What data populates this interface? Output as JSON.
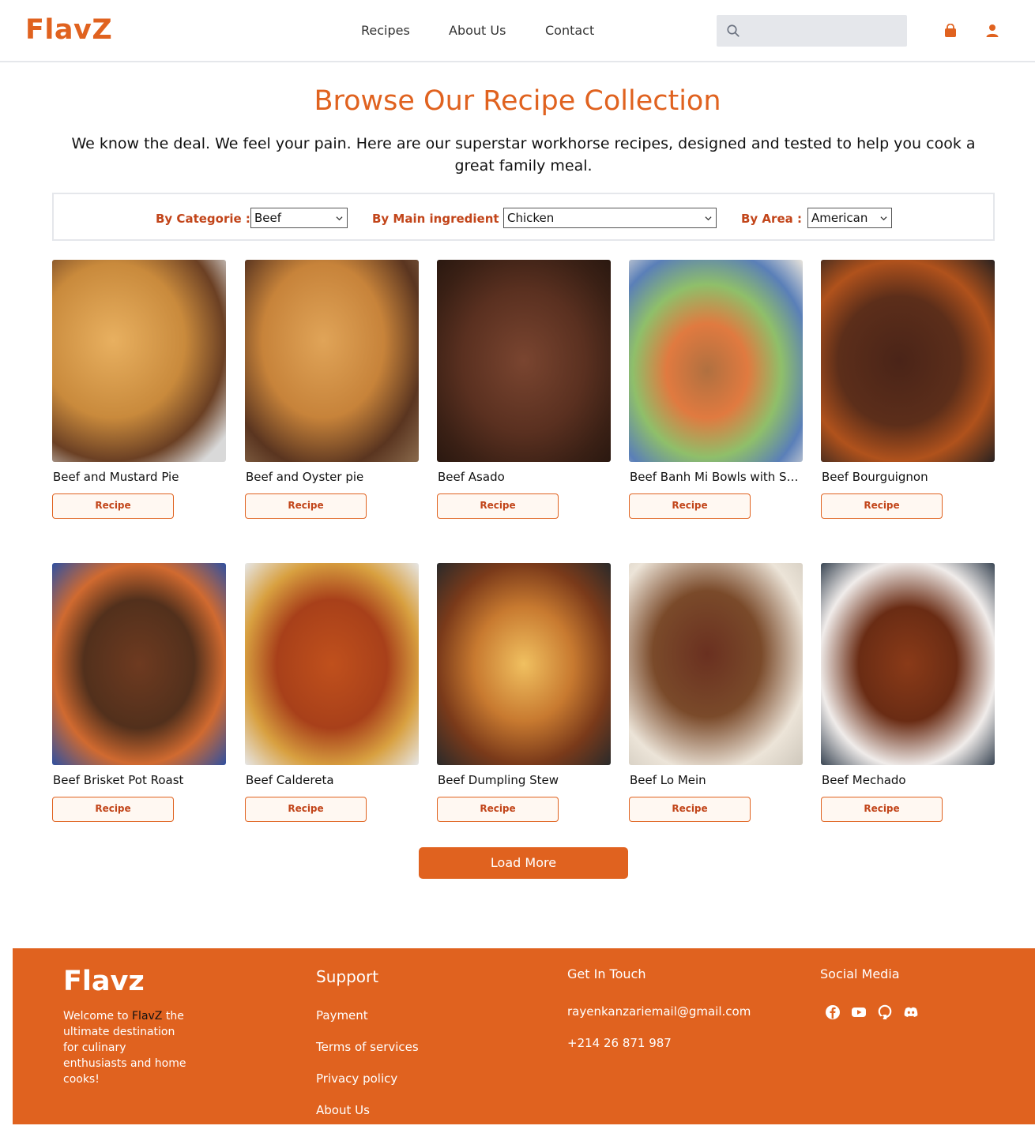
{
  "header": {
    "logo": "FlavZ",
    "nav": [
      "Recipes",
      "About Us",
      "Contact"
    ],
    "search_placeholder": ""
  },
  "hero": {
    "title": "Browse Our Recipe Collection",
    "subtitle": "We know the deal. We feel your pain. Here are our superstar workhorse recipes, designed and tested to help you cook a great family meal."
  },
  "filters": {
    "category_label": "By Categorie :",
    "category_value": "Beef",
    "ingredient_label": "By Main ingredient :",
    "ingredient_value": "Chicken",
    "area_label": "By Area :",
    "area_value": "American"
  },
  "recipes": [
    {
      "name": "Beef and Mustard Pie",
      "button": "Recipe"
    },
    {
      "name": "Beef and Oyster pie",
      "button": "Recipe"
    },
    {
      "name": "Beef Asado",
      "button": "Recipe"
    },
    {
      "name": "Beef Banh Mi Bowls with Sriracha Mayo, Carrot & Pickled Cucumber",
      "button": "Recipe"
    },
    {
      "name": "Beef Bourguignon",
      "button": "Recipe"
    },
    {
      "name": "Beef Brisket Pot Roast",
      "button": "Recipe"
    },
    {
      "name": "Beef Caldereta",
      "button": "Recipe"
    },
    {
      "name": "Beef Dumpling Stew",
      "button": "Recipe"
    },
    {
      "name": "Beef Lo Mein",
      "button": "Recipe"
    },
    {
      "name": "Beef Mechado",
      "button": "Recipe"
    }
  ],
  "load_more": "Load More",
  "footer": {
    "brand": "Flavz",
    "desc_pre": "Welcome to ",
    "desc_hl": "FlavZ",
    "desc_post": " the ultimate destination for culinary enthusiasts and home cooks!",
    "support_heading": "Support",
    "support_links": [
      "Payment",
      "Terms of services",
      "Privacy policy",
      "About Us"
    ],
    "contact_heading": "Get In Touch",
    "email": "rayenkanzariemail@gmail.com",
    "phone": "+214 26 871 987",
    "social_heading": "Social Media",
    "social_icons": [
      "facebook-icon",
      "youtube-icon",
      "github-icon",
      "discord-icon"
    ]
  },
  "colors": {
    "accent": "#e0621f",
    "accent_dark": "#c2451a"
  }
}
